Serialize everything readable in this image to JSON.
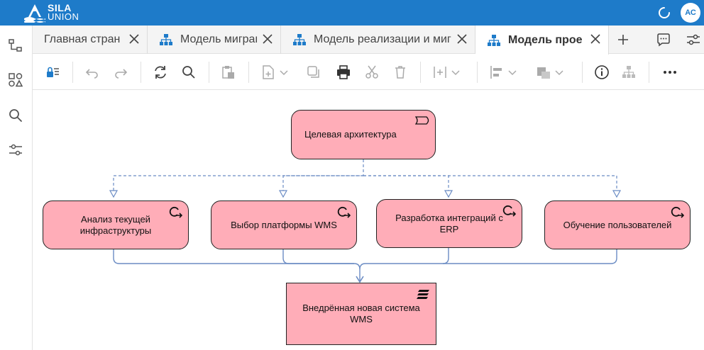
{
  "app": {
    "brand_line1": "SILA",
    "brand_line2": "UNION",
    "user_initials": "АС"
  },
  "tabs": [
    {
      "label": "Главная страница",
      "active": false,
      "has_icon": false
    },
    {
      "label": "Модель миграции",
      "active": false,
      "has_icon": true
    },
    {
      "label": "Модель реализации и миграции",
      "active": false,
      "has_icon": true
    },
    {
      "label": "Модель проекта",
      "active": true,
      "has_icon": true
    }
  ],
  "toolbar": {
    "icons": [
      "lock-list-icon",
      "undo-icon",
      "redo-icon",
      "refresh-icon",
      "search-icon",
      "paste-icon",
      "new-element-icon",
      "copy-icon",
      "print-icon",
      "cut-icon",
      "delete-icon",
      "insert-column-icon",
      "align-icon",
      "style-icon",
      "info-icon",
      "hierarchy-icon",
      "more-icon"
    ]
  },
  "diagram": {
    "nodes": [
      {
        "id": "goal",
        "label": "Целевая архитектура",
        "kind": "goal"
      },
      {
        "id": "n1",
        "label": "Анализ текущей инфраструктуры",
        "kind": "process"
      },
      {
        "id": "n2",
        "label": "Выбор платформы WMS",
        "kind": "process"
      },
      {
        "id": "n3",
        "label": "Разработка интеграций с ERP",
        "kind": "process"
      },
      {
        "id": "n4",
        "label": "Обучение пользователей",
        "kind": "process"
      },
      {
        "id": "result",
        "label": "Внедрённая новая система WMS",
        "kind": "deliverable"
      }
    ],
    "colors": {
      "node_fill": "#ffadb8",
      "node_border": "#222222",
      "connector_dashed": "#6b8cc4",
      "connector_solid": "#6b8cc4",
      "brand": "#1e7bc9"
    }
  }
}
